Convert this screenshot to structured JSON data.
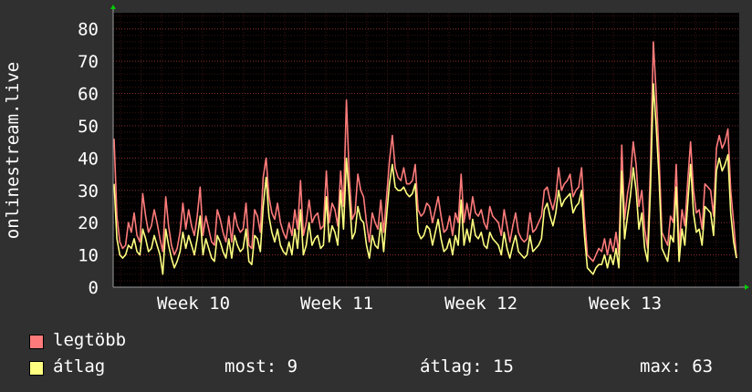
{
  "chart_data": {
    "type": "line",
    "ylabel": "onlinestream.live",
    "xlabel": "",
    "ylim": [
      0,
      85
    ],
    "yticks": [
      0,
      10,
      20,
      30,
      40,
      50,
      60,
      70,
      80
    ],
    "xtick_labels": [
      "Week 10",
      "Week 11",
      "Week 12",
      "Week 13"
    ],
    "grid": true,
    "legend_position": "bottom-left",
    "background": "#000000",
    "page_background": "#303030",
    "grid_color": "#8a2c2c",
    "series": [
      {
        "name": "legtöbb",
        "color": "#ff7b7b",
        "values": [
          46,
          22,
          14,
          12,
          13,
          20,
          17,
          23,
          16,
          14,
          29,
          22,
          17,
          19,
          24,
          20,
          15,
          11,
          28,
          19,
          13,
          10,
          12,
          17,
          26,
          18,
          24,
          19,
          16,
          22,
          31,
          16,
          22,
          18,
          14,
          13,
          24,
          21,
          17,
          14,
          22,
          14,
          23,
          19,
          17,
          18,
          26,
          13,
          12,
          24,
          22,
          17,
          34,
          40,
          28,
          23,
          21,
          26,
          20,
          17,
          15,
          20,
          16,
          24,
          18,
          33,
          16,
          20,
          27,
          20,
          22,
          23,
          18,
          19,
          36,
          20,
          26,
          24,
          19,
          36,
          25,
          58,
          34,
          21,
          23,
          35,
          30,
          28,
          20,
          14,
          23,
          20,
          18,
          27,
          17,
          28,
          39,
          47,
          37,
          34,
          33,
          37,
          32,
          32,
          33,
          38,
          24,
          22,
          23,
          26,
          25,
          20,
          24,
          28,
          22,
          17,
          18,
          22,
          16,
          23,
          20,
          35,
          20,
          26,
          21,
          28,
          23,
          22,
          24,
          20,
          18,
          25,
          22,
          21,
          20,
          16,
          24,
          19,
          14,
          19,
          23,
          17,
          15,
          14,
          15,
          23,
          17,
          18,
          20,
          22,
          30,
          31,
          27,
          24,
          28,
          37,
          30,
          32,
          33,
          35,
          28,
          30,
          31,
          37,
          22,
          10,
          9,
          8,
          10,
          12,
          11,
          15,
          10,
          15,
          11,
          17,
          10,
          44,
          21,
          29,
          34,
          45,
          38,
          25,
          30,
          18,
          12,
          37,
          76,
          60,
          41,
          17,
          15,
          13,
          22,
          20,
          38,
          12,
          24,
          19,
          33,
          45,
          30,
          23,
          24,
          18,
          32,
          31,
          30,
          22,
          43,
          47,
          43,
          45,
          49,
          30,
          20,
          9
        ]
      },
      {
        "name": "átlag",
        "color": "#ffff80",
        "values": [
          32,
          15,
          10,
          9,
          10,
          13,
          12,
          15,
          11,
          10,
          18,
          15,
          11,
          12,
          16,
          13,
          10,
          4,
          18,
          13,
          9,
          6,
          8,
          11,
          17,
          12,
          16,
          13,
          10,
          15,
          22,
          10,
          15,
          12,
          9,
          8,
          16,
          14,
          11,
          9,
          15,
          9,
          16,
          13,
          11,
          12,
          18,
          8,
          7,
          16,
          15,
          11,
          25,
          34,
          22,
          17,
          14,
          18,
          13,
          11,
          10,
          14,
          10,
          18,
          12,
          24,
          10,
          13,
          20,
          13,
          15,
          16,
          12,
          13,
          28,
          14,
          19,
          17,
          13,
          30,
          18,
          40,
          28,
          15,
          17,
          25,
          21,
          20,
          13,
          9,
          16,
          13,
          12,
          20,
          11,
          22,
          32,
          38,
          31,
          30,
          30,
          31,
          29,
          28,
          29,
          32,
          17,
          15,
          16,
          19,
          18,
          13,
          17,
          21,
          15,
          11,
          12,
          15,
          10,
          16,
          13,
          27,
          13,
          18,
          14,
          21,
          16,
          15,
          17,
          13,
          12,
          17,
          15,
          14,
          13,
          10,
          17,
          12,
          9,
          13,
          16,
          11,
          10,
          9,
          10,
          16,
          11,
          12,
          13,
          15,
          24,
          26,
          22,
          19,
          23,
          30,
          25,
          27,
          28,
          29,
          23,
          25,
          26,
          30,
          16,
          6,
          5,
          4,
          6,
          7,
          7,
          10,
          6,
          10,
          7,
          12,
          6,
          36,
          15,
          22,
          28,
          37,
          30,
          18,
          23,
          12,
          8,
          30,
          63,
          50,
          34,
          12,
          10,
          8,
          16,
          14,
          31,
          8,
          18,
          13,
          26,
          38,
          23,
          17,
          18,
          13,
          25,
          24,
          23,
          16,
          36,
          40,
          36,
          38,
          41,
          23,
          14,
          9
        ]
      }
    ]
  },
  "legend": {
    "items": [
      {
        "label": "legtöbb",
        "color": "#ff7b7b"
      },
      {
        "label": "átlag",
        "color": "#ffff80"
      }
    ],
    "now_label": "most: 9",
    "avg_label": "átlag: 15",
    "max_label": "max: 63"
  }
}
